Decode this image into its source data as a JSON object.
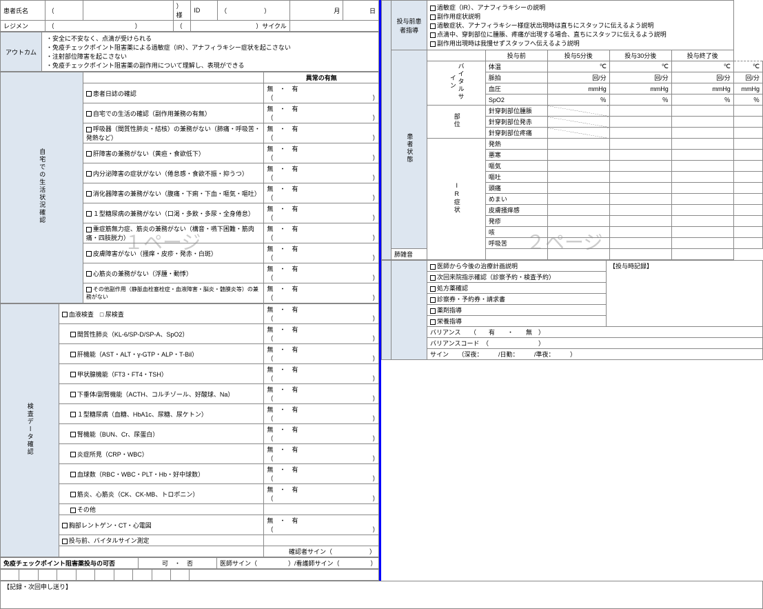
{
  "header": {
    "patient_name": "患者氏名",
    "sama": "様",
    "id": "ID",
    "year": "",
    "month": "月",
    "day": "日",
    "regimen": "レジメン",
    "cycle": "サイクル",
    "outcome_label": "アウトカム",
    "outcome_list": [
      "・安全に不安なく、点滴が受けられる",
      "・免疫チェックポイント阻害薬による過敏症（IR）、アナフィラキシー症状を起こさない",
      "・注射部位障害を起こさない",
      "・免疫チェックポイント阻害薬の副作用について理解し、表現ができる"
    ]
  },
  "abnormal_header": "異常の有無",
  "home_label": "自宅での生活状況確認",
  "home_items": [
    "患者日誌の確認",
    "自宅での生活の確認（副作用兼務の有無）",
    "呼吸器（間質性肺炎・結核）の兼務がない（肺痛・呼吸苦・発熱など）",
    "肝障害の兼務がない（黄疸・食欲低下）",
    "内分泌障害の症状がない（倦怠感・食欲不振・抑うつ）",
    "消化器障害の兼務がない（腹痛・下痢・下血・嘔気・嘔吐）",
    "１型糖尿病の兼務がない（口渇・多飲・多尿・全身倦怠）",
    "重症筋無力症、筋炎の兼務がない（構音・嚥下困難・筋肉痛・四肢脱力）",
    "皮膚障害がない（掻痒・皮疹・発赤・白斑）",
    "心筋炎の兼務がない（浮腫・動悸）",
    "その他副作用（静脈血栓塞栓症・血液障害・脳炎・髄膜炎等）の兼務がない"
  ],
  "lab_label": "検査データ確認",
  "lab_head": "血液検査　□ 尿検査",
  "lab_items": [
    "間質性肺炎（KL-6/SP-D/SP-A、SpO2）",
    "肝機能（AST・ALT・γ-GTP・ALP・T-Bil）",
    "甲状腺機能（FT3・FT4・TSH）",
    "下垂体/副腎機能（ACTH、コルチゾール、好酸球、Na）",
    "１型糖尿病（血糖、HbA1c、尿糖、尿ケトン）",
    "腎機能（BUN、Cr、尿蛋白）",
    "炎症所見（CRP・WBC）",
    "血球数（RBC・WBC・PLT・Hb・好中球数）",
    "筋炎、心筋炎（CK、CK-MB、トロポニン）",
    "その他"
  ],
  "lab_after": [
    "胸部レントゲン・CT・心電図",
    "投与前、バイタルサイン測定"
  ],
  "na_ari": "無　・　有",
  "brackets": "（　　　　　　　　　　　　　　　　）",
  "sign_row": {
    "confirm": "確認者サイン（　　　　　　）"
  },
  "approval": {
    "label": "免疫チェックポイント阻害薬投与の可否",
    "kahi": "可　・　否",
    "sign": "医師サイン（　　　　　）/看護師サイン（　　　　　）"
  },
  "page1_wm": "１ページ",
  "p2_edu_label": "投与前患者指導",
  "p2_edu": [
    "過敏症（IR）、アナフィラキシーの説明",
    "副作用症状説明",
    "過敏症状、アナフィラキシー様症状出現時は直ちにスタッフに伝えるよう説明",
    "点滴中、穿刺部位に腫脹、疼痛が出現する場合、直ちにスタッフに伝えるよう説明",
    "副作用出現時は我慢せずスタッフへ伝えるよう説明"
  ],
  "time_cols": [
    "投与前",
    "投与5分後",
    "投与30分後",
    "投与終了後"
  ],
  "patient_state_label": "患者状態",
  "vital_label": "バイタルサイン",
  "vitals": [
    {
      "name": "体温",
      "unit": "℃"
    },
    {
      "name": "脈拍",
      "unit": "回/分"
    },
    {
      "name": "血圧",
      "unit": "mmHg"
    },
    {
      "name": "SpO2",
      "unit": "％"
    }
  ],
  "site_label": "部位",
  "site_items": [
    "針穿刺部位腫脹",
    "針穿刺部位発赤",
    "針穿刺部位疼痛"
  ],
  "ir_label": "IR症状",
  "ir_items": [
    "発熱",
    "悪寒",
    "嘔気",
    "嘔吐",
    "頭痛",
    "めまい",
    "皮膚掻痒感",
    "発疹",
    "咳",
    "呼吸苦",
    "肺雑音"
  ],
  "bottom_items": [
    "医師から今後の治療計画説明",
    "次回来院指示確認（診察予約・検査予約）",
    "処方薬確認",
    "診察券・予約券・請求書",
    "薬剤指導",
    "栄養指導"
  ],
  "admin_record": "【投与時記録】",
  "variance": "バリアンス　　（　　有　　・　　無　）",
  "variance_code": "バリアンスコード　（　　　　　　　　）",
  "sign_line": "サイン　　（深夜：　　　/日勤：　　　/準夜：　　　）",
  "special": "【記録・次回申し送り】",
  "page2_wm": "２ページ"
}
